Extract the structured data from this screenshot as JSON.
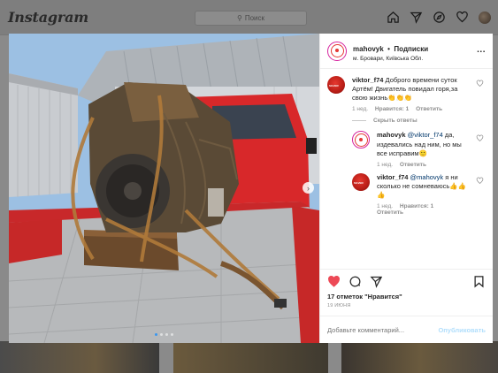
{
  "header": {
    "logo": "Instagram",
    "search_placeholder": "Поиск",
    "icons": [
      "home-icon",
      "direct-icon",
      "explore-icon",
      "activity-heart-icon",
      "profile-avatar"
    ]
  },
  "post": {
    "author": "mahovyk",
    "follow_status": "Подписки",
    "separator": "•",
    "location": "м. Бровари, Київська Обл.",
    "more_label": "...",
    "carousel": {
      "total": 4,
      "active": 1
    },
    "comments": [
      {
        "user": "viktor_f74",
        "text": "Доброго времени суток Артём! Двигатель повидал горя,за свою жизнь👏👏👏",
        "time": "1 нед.",
        "likes_label": "Нравится: 1",
        "reply_label": "Ответить"
      }
    ],
    "hide_replies_label": "Скрыть ответы",
    "replies": [
      {
        "user": "mahovyk",
        "mention": "@viktor_f74",
        "text": " да, издевались над ним, но мы все исправим🙂",
        "time": "1 нед.",
        "reply_label": "Ответить"
      },
      {
        "user": "viktor_f74",
        "mention": "@mahovyk",
        "text": " я ни сколько не сомневаюсь👍👍👍",
        "time": "1 нед.",
        "likes_label": "Нравится: 1",
        "reply_label": "Ответить"
      }
    ],
    "likes_text": "17 отметок \"Нравится\"",
    "date_text": "19 ИЮНЯ",
    "add_comment_placeholder": "Добавьте комментарий...",
    "post_button": "Опубликовать"
  },
  "colors": {
    "like_red": "#ed4956",
    "link_blue": "#3897f0",
    "post_button_disabled": "#b2dffc",
    "text": "#262626",
    "muted": "#8e8e8e"
  }
}
